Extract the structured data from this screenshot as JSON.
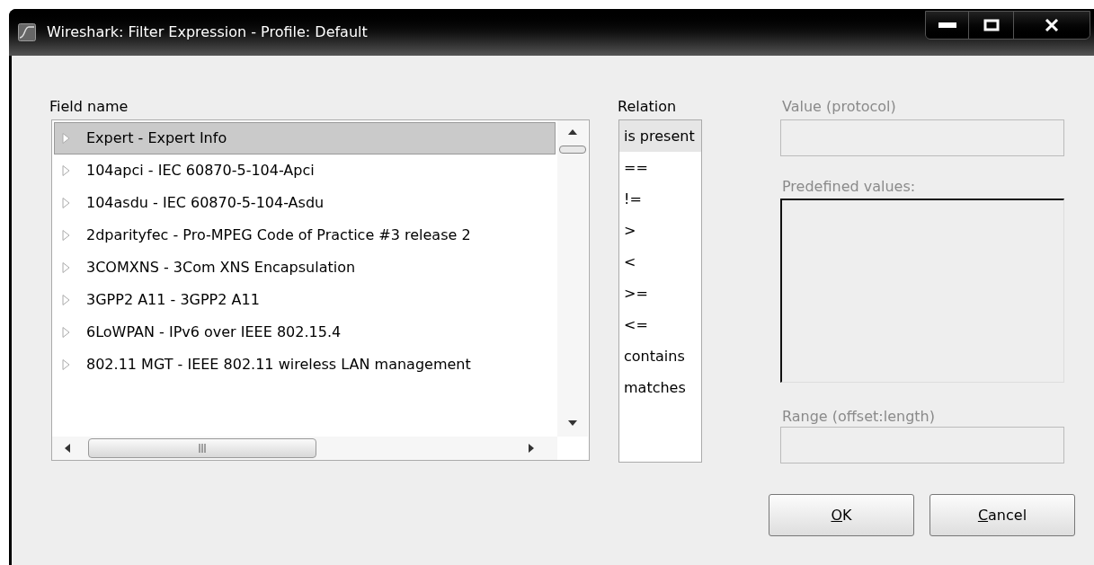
{
  "window": {
    "title": "Wireshark: Filter Expression - Profile: Default"
  },
  "field_name": {
    "label": "Field name",
    "items": [
      {
        "label": "Expert - Expert Info",
        "expanded": false,
        "selected": true
      },
      {
        "label": "104apci - IEC 60870-5-104-Apci",
        "expanded": false,
        "selected": false
      },
      {
        "label": "104asdu - IEC 60870-5-104-Asdu",
        "expanded": false,
        "selected": false
      },
      {
        "label": "2dparityfec - Pro-MPEG Code of Practice #3 release 2",
        "expanded": false,
        "selected": false
      },
      {
        "label": "3COMXNS - 3Com XNS Encapsulation",
        "expanded": false,
        "selected": false
      },
      {
        "label": "3GPP2 A11 - 3GPP2 A11",
        "expanded": false,
        "selected": false
      },
      {
        "label": "6LoWPAN - IPv6 over IEEE 802.15.4",
        "expanded": false,
        "selected": false
      },
      {
        "label": "802.11 MGT - IEEE 802.11 wireless LAN management",
        "expanded": false,
        "selected": false
      }
    ]
  },
  "relation": {
    "label": "Relation",
    "items": [
      {
        "label": "is present",
        "selected": true
      },
      {
        "label": "==",
        "selected": false
      },
      {
        "label": "!=",
        "selected": false
      },
      {
        "label": ">",
        "selected": false
      },
      {
        "label": "<",
        "selected": false
      },
      {
        "label": ">=",
        "selected": false
      },
      {
        "label": "<=",
        "selected": false
      },
      {
        "label": "contains",
        "selected": false
      },
      {
        "label": "matches",
        "selected": false
      }
    ]
  },
  "value": {
    "label": "Value (protocol)",
    "disabled": true
  },
  "predefined_values": {
    "label": "Predefined values:",
    "disabled": true
  },
  "range": {
    "label": "Range (offset:length)",
    "disabled": true
  },
  "buttons": [
    {
      "label": "OK",
      "first_letter_underlined": true
    },
    {
      "label": "Cancel",
      "first_letter_underlined": true
    }
  ]
}
